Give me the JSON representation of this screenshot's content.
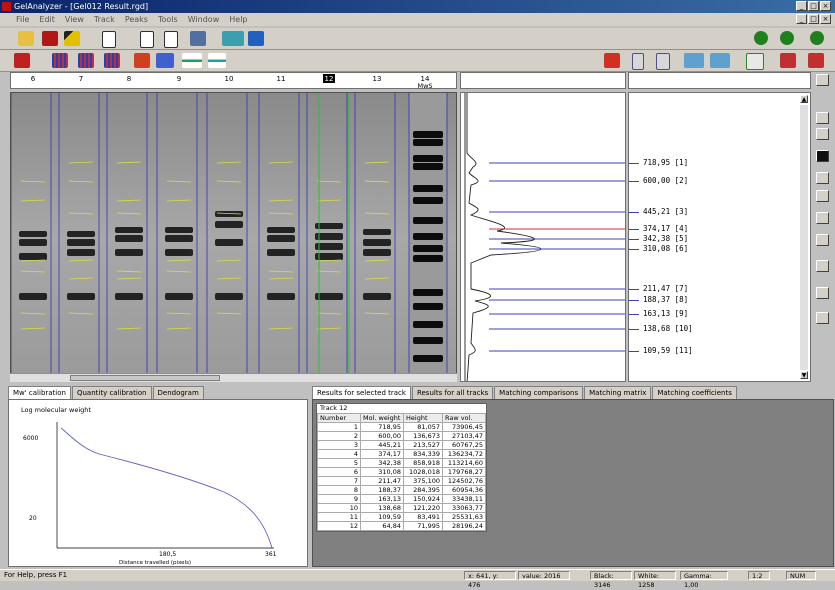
{
  "window": {
    "title": "GelAnalyzer - [Gel012 Result.rgd]",
    "menu": [
      "File",
      "Edit",
      "View",
      "Track",
      "Peaks",
      "Tools",
      "Window",
      "Help"
    ]
  },
  "lanes": {
    "labels": [
      "6",
      "7",
      "8",
      "9",
      "10",
      "11",
      "12",
      "13",
      "14"
    ],
    "marker_label": "MwS"
  },
  "bands": {
    "entries": [
      {
        "label": "718,95 [1]",
        "y": 162
      },
      {
        "label": "600,00 [2]",
        "y": 180
      },
      {
        "label": "445,21 [3]",
        "y": 211
      },
      {
        "label": "374,17 [4]",
        "y": 228
      },
      {
        "label": "342,38 [5]",
        "y": 238
      },
      {
        "label": "310,08 [6]",
        "y": 248
      },
      {
        "label": "211,47 [7]",
        "y": 288
      },
      {
        "label": "188,37 [8]",
        "y": 299
      },
      {
        "label": "163,13 [9]",
        "y": 313
      },
      {
        "label": "138,68 [10]",
        "y": 328
      },
      {
        "label": "109,59 [11]",
        "y": 350
      }
    ]
  },
  "left_tabs": [
    "Mw' calibration",
    "Quantity calibration",
    "Dendogram"
  ],
  "calibration": {
    "ylabel": "Log molecular weight",
    "xlabel": "Distance travelled (pixels)",
    "y_ticks": [
      "6000",
      "20"
    ],
    "x_ticks": [
      "0",
      "180,5",
      "361"
    ]
  },
  "right_tabs": [
    "Results for selected track",
    "Results for all tracks",
    "Matching comparisons",
    "Matching matrix",
    "Matching coefficients"
  ],
  "results": {
    "track_label": "Track 12",
    "headers": [
      "Number",
      "Mol. weight",
      "Height",
      "Raw vol."
    ],
    "rows": [
      [
        "1",
        "718,95",
        "81,057",
        "73906,45"
      ],
      [
        "2",
        "600,00",
        "136,673",
        "27103,47"
      ],
      [
        "3",
        "445,21",
        "213,527",
        "60767,25"
      ],
      [
        "4",
        "374,17",
        "834,339",
        "136234,72"
      ],
      [
        "5",
        "342,38",
        "858,918",
        "113214,60"
      ],
      [
        "6",
        "310,08",
        "1028,018",
        "179768,27"
      ],
      [
        "7",
        "211,47",
        "375,100",
        "124502,76"
      ],
      [
        "8",
        "188,37",
        "284,395",
        "60954,36"
      ],
      [
        "9",
        "163,13",
        "150,924",
        "33438,11"
      ],
      [
        "10",
        "138,68",
        "121,220",
        "33063,77"
      ],
      [
        "11",
        "109,59",
        "83,491",
        "25531,63"
      ],
      [
        "12",
        "64,84",
        "71,995",
        "28196,24"
      ]
    ]
  },
  "status": {
    "help": "For Help, press F1",
    "coords": "x: 641, y: 476",
    "value": "value: 2016",
    "black": "Black: 3146",
    "white": "White: 1258",
    "gamma": "Gamma: 1,00",
    "zoom": "1:2",
    "num": "NUM"
  }
}
